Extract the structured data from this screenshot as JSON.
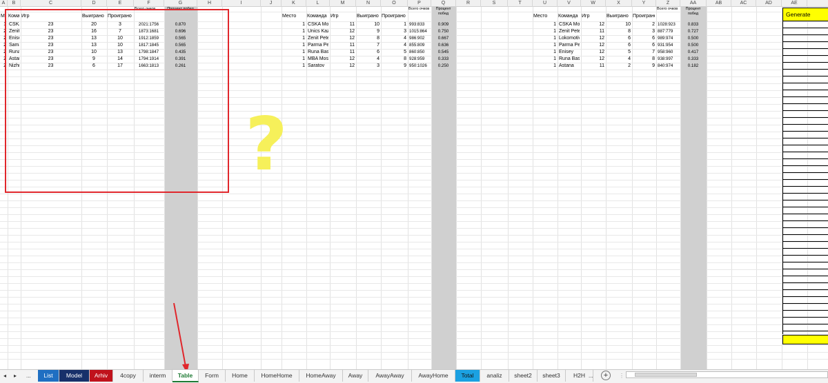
{
  "columns": [
    "A",
    "B",
    "C",
    "D",
    "E",
    "F",
    "G",
    "H",
    "I",
    "J",
    "K",
    "L",
    "M",
    "N",
    "O",
    "P",
    "Q",
    "R",
    "S",
    "T",
    "U",
    "V",
    "W",
    "X",
    "Y",
    "Z",
    "AA",
    "AB",
    "AC",
    "AD",
    "AE"
  ],
  "table1": {
    "headers": {
      "place": "Место",
      "team": "Команда",
      "games": "Игр",
      "won": "Выиграно",
      "lost": "Проиграно",
      "points": "Всего очков",
      "pct": "Процент побед"
    },
    "rows": [
      {
        "place": "1",
        "team": "CSKA Moscow",
        "games": "23",
        "won": "20",
        "lost": "3",
        "points": "2021:1756",
        "pct": "0.870"
      },
      {
        "place": "2",
        "team": "Zenit Petersburg",
        "games": "23",
        "won": "16",
        "lost": "7",
        "points": "1873:1681",
        "pct": "0.696"
      },
      {
        "place": "2",
        "team": "Enisey",
        "games": "23",
        "won": "13",
        "lost": "10",
        "points": "1912:1859",
        "pct": "0.565"
      },
      {
        "place": "2",
        "team": "Samara",
        "games": "23",
        "won": "13",
        "lost": "10",
        "points": "1817:1845",
        "pct": "0.565"
      },
      {
        "place": "2",
        "team": "Runa Basket Moscow",
        "games": "23",
        "won": "10",
        "lost": "13",
        "points": "1798:1847",
        "pct": "0.435"
      },
      {
        "place": "2",
        "team": "Astana",
        "games": "23",
        "won": "9",
        "lost": "14",
        "points": "1794:1914",
        "pct": "0.391"
      },
      {
        "place": "2",
        "team": "Nizhny Novgorod",
        "games": "23",
        "won": "6",
        "lost": "17",
        "points": "1663:1813",
        "pct": "0.261"
      }
    ]
  },
  "table2": {
    "headers": {
      "place": "Место",
      "team": "Команда",
      "games": "Игр",
      "won": "Выиграно",
      "lost": "Проиграно",
      "points": "Всего очков",
      "pct": "Процент побед"
    },
    "rows": [
      {
        "place": "1",
        "team": "CSKA Mos",
        "games": "11",
        "won": "10",
        "lost": "1",
        "points": "993:833",
        "pct": "0.909"
      },
      {
        "place": "1",
        "team": "Unics Kaz",
        "games": "12",
        "won": "9",
        "lost": "3",
        "points": "1015:864",
        "pct": "0.750"
      },
      {
        "place": "1",
        "team": "Zenit Pete",
        "games": "12",
        "won": "8",
        "lost": "4",
        "points": "986:902",
        "pct": "0.667"
      },
      {
        "place": "1",
        "team": "Parma Pe",
        "games": "11",
        "won": "7",
        "lost": "4",
        "points": "855:809",
        "pct": "0.636"
      },
      {
        "place": "1",
        "team": "Runa Bas",
        "games": "11",
        "won": "6",
        "lost": "5",
        "points": "860:850",
        "pct": "0.545"
      },
      {
        "place": "1",
        "team": "MBA Mos",
        "games": "12",
        "won": "4",
        "lost": "8",
        "points": "928:959",
        "pct": "0.333"
      },
      {
        "place": "1",
        "team": "Saratov",
        "games": "12",
        "won": "3",
        "lost": "9",
        "points": "950:1026",
        "pct": "0.250"
      }
    ]
  },
  "table3": {
    "headers": {
      "place": "Место",
      "team": "Команда",
      "games": "Игр",
      "won": "Выиграно",
      "lost": "Проиграно",
      "points": "Всего очков",
      "pct": "Процент побед"
    },
    "rows": [
      {
        "place": "1",
        "team": "CSKA Mos",
        "games": "12",
        "won": "10",
        "lost": "2",
        "points": "1028:923",
        "pct": "0.833"
      },
      {
        "place": "1",
        "team": "Zenit Pete",
        "games": "11",
        "won": "8",
        "lost": "3",
        "points": "887:779",
        "pct": "0.727"
      },
      {
        "place": "1",
        "team": "Lokomotiv",
        "games": "12",
        "won": "6",
        "lost": "6",
        "points": "989:974",
        "pct": "0.500"
      },
      {
        "place": "1",
        "team": "Parma Pe",
        "games": "12",
        "won": "6",
        "lost": "6",
        "points": "931:954",
        "pct": "0.500"
      },
      {
        "place": "1",
        "team": "Enisey",
        "games": "12",
        "won": "5",
        "lost": "7",
        "points": "958:960",
        "pct": "0.417"
      },
      {
        "place": "1",
        "team": "Runa Bas",
        "games": "12",
        "won": "4",
        "lost": "8",
        "points": "938:997",
        "pct": "0.333"
      },
      {
        "place": "1",
        "team": "Astana",
        "games": "11",
        "won": "2",
        "lost": "9",
        "points": "840:974",
        "pct": "0.182"
      }
    ]
  },
  "ae_header": "Generate",
  "annotation": {
    "question_mark": "?"
  },
  "sheet_tabs": {
    "nav_prev": "◂",
    "nav_next": "▸",
    "more_left": "...",
    "more_right": "...",
    "add": "+",
    "items": [
      {
        "label": "List",
        "bg": "#1f6fc2",
        "fg": "#ffffff"
      },
      {
        "label": "Model",
        "bg": "#17306a",
        "fg": "#ffffff"
      },
      {
        "label": "Arhiv",
        "bg": "#c0121c",
        "fg": "#ffffff"
      },
      {
        "label": "4copy",
        "bg": "#f3f3f3",
        "fg": "#333333"
      },
      {
        "label": "interm",
        "bg": "#f3f3f3",
        "fg": "#333333"
      },
      {
        "label": "Table",
        "bg": "#ffffff",
        "fg": "#1e7a34",
        "active": true
      },
      {
        "label": "Form",
        "bg": "#f3f3f3",
        "fg": "#333333"
      },
      {
        "label": "Home",
        "bg": "#f3f3f3",
        "fg": "#333333"
      },
      {
        "label": "HomeHome",
        "bg": "#f3f3f3",
        "fg": "#333333"
      },
      {
        "label": "HomeAway",
        "bg": "#f3f3f3",
        "fg": "#333333"
      },
      {
        "label": "Away",
        "bg": "#f3f3f3",
        "fg": "#333333"
      },
      {
        "label": "AwayAway",
        "bg": "#f3f3f3",
        "fg": "#333333"
      },
      {
        "label": "AwayHome",
        "bg": "#f3f3f3",
        "fg": "#333333"
      },
      {
        "label": "Total",
        "bg": "#1ba1e2",
        "fg": "#111111"
      },
      {
        "label": "analiz",
        "bg": "#f3f3f3",
        "fg": "#333333"
      },
      {
        "label": "sheet2",
        "bg": "#f3f3f3",
        "fg": "#333333"
      },
      {
        "label": "sheet3",
        "bg": "#f3f3f3",
        "fg": "#333333"
      },
      {
        "label": "H2H",
        "bg": "#f3f3f3",
        "fg": "#333333"
      }
    ]
  },
  "colors": {
    "gray_column": "#d0d0d0",
    "red_frame": "#e0262b",
    "yellow": "#ffff00",
    "question_yellow": "#f6f05a"
  }
}
